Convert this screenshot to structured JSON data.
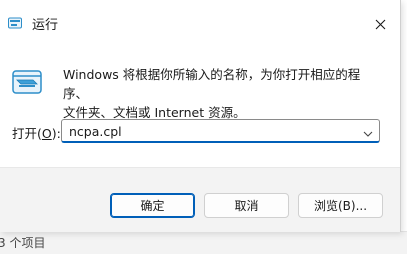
{
  "window": {
    "title": "运行",
    "close_glyph": "✕"
  },
  "description": {
    "line1": "Windows 将根据你所输入的名称，为你打开相应的程序、",
    "line2": "文件夹、文档或 Internet 资源。"
  },
  "open_field": {
    "label_prefix": "打开(",
    "label_key": "O",
    "label_suffix": "):",
    "value": "ncpa.cpl"
  },
  "buttons": {
    "ok": "确定",
    "cancel": "取消",
    "browse": "浏览(B)..."
  },
  "background": {
    "status_text": "3 个项目"
  },
  "icons": {
    "title_icon": "run-app-icon",
    "large_icon": "run-app-icon",
    "close": "close-icon",
    "dropdown": "chevron-down-icon"
  },
  "colors": {
    "accent": "#005fb8",
    "footer_bg": "#f3f3f3",
    "icon_blue": "#2d8ec9"
  }
}
